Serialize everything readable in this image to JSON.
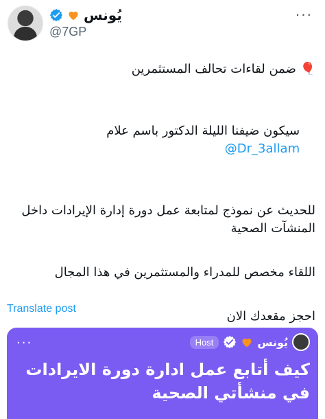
{
  "post": {
    "author_name": "يُونس",
    "handle": "@7GP",
    "more_label": "···",
    "lines": [
      "🎈 ضمن لقاءات تحالف المستثمرين",
      "",
      "سيكون ضيفنا الليلة الدكتور باسم علام",
      "",
      "للحديث عن نموذج لمتابعة عمل دورة إدارة الإيرادات داخل المنشآت الصحية",
      "",
      "اللقاء مخصص للمدراء والمستثمرين في هذا المجال",
      "",
      "احجز مقعدك الان"
    ],
    "mention": "@Dr_3allam",
    "translate_label": "Translate post"
  },
  "card": {
    "host_name": "يُونس",
    "host_label": "Host",
    "more_label": "···",
    "title": "كيف أتابع عمل ادارة دورة الايرادات في منشأتي الصحية"
  },
  "colors": {
    "accent": "#1d9bf0",
    "card_bg": "#7b5cf2",
    "heart": "#f7931e"
  }
}
